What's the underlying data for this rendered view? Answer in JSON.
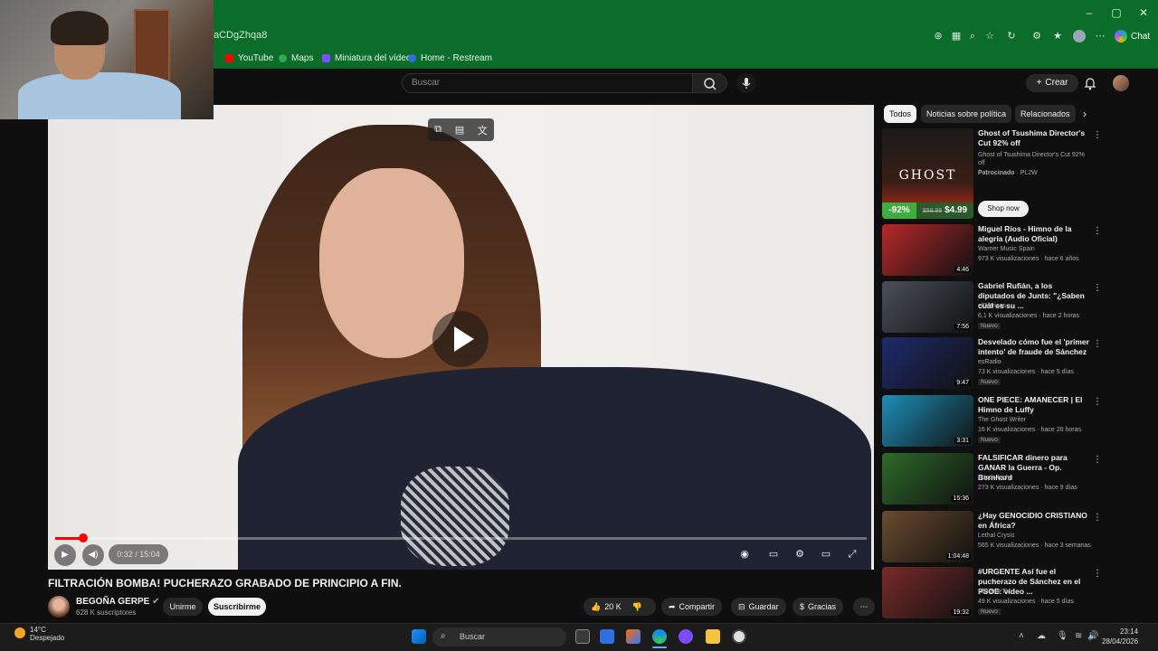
{
  "browser": {
    "url_fragment": "aCDgZhqa8",
    "chat_label": "Chat",
    "bookmarks": [
      {
        "label": "YouTube",
        "color": "#ff0000"
      },
      {
        "label": "Maps",
        "color": "#34a853"
      },
      {
        "label": "Miniatura del vídeo",
        "color": "#7c4dff"
      },
      {
        "label": "Home - Restream",
        "color": "#2f6fe4"
      }
    ]
  },
  "header": {
    "search_placeholder": "Buscar",
    "create_label": "Crear"
  },
  "player": {
    "time": "0:32 / 15:04",
    "progress_fraction": 0.035
  },
  "video": {
    "title": "FILTRACIÓN BOMBA! PUCHERAZO GRABADO DE PRINCIPIO A FIN.",
    "channel": "BEGOÑA GERPE",
    "subscribers": "628 K suscriptores",
    "join_label": "Unirme",
    "subscribe_label": "Suscribirme",
    "likes": "20 K",
    "share_label": "Compartir",
    "save_label": "Guardar",
    "thanks_label": "Gracias"
  },
  "chips": [
    "Todos",
    "Noticias sobre política",
    "Relacionados"
  ],
  "ad": {
    "title": "Ghost of Tsushima Director's Cut 92% off",
    "description": "Ghost of Tsushima Director's Cut 92% off",
    "sponsor": "Patrocinado",
    "advertiser": "PL2W",
    "cta": "Shop now",
    "thumb_word": "GHOST",
    "discount": "-92%",
    "price": "$4.99",
    "old_price": "$59.99"
  },
  "recommendations": [
    {
      "title": "Miguel Ríos - Himno de la alegría (Audio Oficial)",
      "channel": "Warner Music Spain",
      "meta": "973 K visualizaciones · hace 6 años",
      "duration": "4:46",
      "new": "",
      "thumb": "#b8282a"
    },
    {
      "title": "Gabriel Rufián, a los diputados de Junts: \"¿Saben cuál es su ...",
      "channel": "elDiarioes",
      "meta": "6,1 K visualizaciones · hace 2 horas",
      "duration": "7:56",
      "new": "Nuevo",
      "thumb": "#4a4f5c"
    },
    {
      "title": "Desvelado cómo fue el 'primer intento' de fraude de Sánchez",
      "channel": "esRadio",
      "meta": "73 K visualizaciones · hace 5 días",
      "duration": "9:47",
      "new": "Nuevo",
      "thumb": "#1e2a6b"
    },
    {
      "title": "ONE PIECE: AMANECER | El Himno de Luffy",
      "channel": "The Ghost Writer",
      "meta": "16 K visualizaciones · hace 20 horas",
      "duration": "3:31",
      "new": "Nuevo",
      "thumb": "#1d8fb8"
    },
    {
      "title": "FALSIFICAR dinero para GANAR la Guerra - Op. Bernhard",
      "channel": "A toda leche",
      "meta": "273 K visualizaciones · hace 9 días",
      "duration": "15:36",
      "new": "",
      "thumb": "#2e6b2a"
    },
    {
      "title": "¿Hay GENOCIDIO CRISTIANO en África?",
      "channel": "Lethal Crysis",
      "meta": "565 K visualizaciones · hace 3 semanas",
      "duration": "1:04:48",
      "new": "",
      "thumb": "#6a4a2e"
    },
    {
      "title": "#URGENTE Así fue el pucherazo de Sánchez en el PSOE: vídeo ...",
      "channel": "ElDiario TV",
      "meta": "49 K visualizaciones · hace 5 días",
      "duration": "19:32",
      "new": "Nuevo",
      "thumb": "#7a2a2a"
    }
  ],
  "taskbar": {
    "temperature": "14°C",
    "weather": "Despejado",
    "search_label": "Buscar",
    "time": "23:14",
    "date": "28/04/2026"
  }
}
